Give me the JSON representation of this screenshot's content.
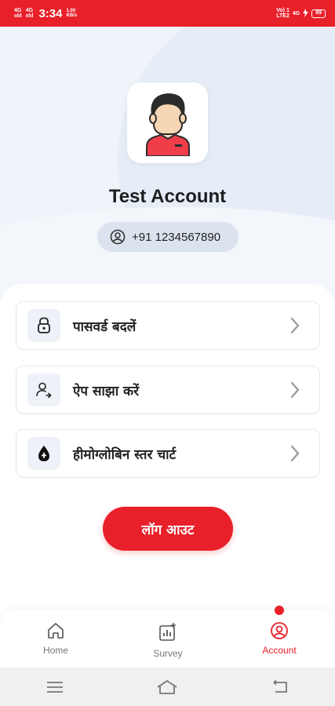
{
  "status_bar": {
    "net1_top": "4G",
    "net1_bottom": "ıılıl",
    "net2_top": "4G",
    "net2_bottom": "ıılıl",
    "time": "3:34",
    "speed_top": "1.00",
    "speed_bottom": "KB/s",
    "volte_top": "Vo) 1",
    "volte_bottom": "LTE2",
    "net3": "4G",
    "battery": "89"
  },
  "profile": {
    "name": "Test Account",
    "phone": "+91 1234567890"
  },
  "menu": [
    {
      "label": "पासवर्ड बदलें",
      "icon": "lock-icon"
    },
    {
      "label": "ऐप साझा करें",
      "icon": "share-user-icon"
    },
    {
      "label": "हीमोग्लोबिन स्तर चार्ट",
      "icon": "blood-drop-icon"
    }
  ],
  "logout_label": "लॉग आउट",
  "bottom_nav": [
    {
      "label": "Home",
      "icon": "home-icon",
      "active": false
    },
    {
      "label": "Survey",
      "icon": "survey-icon",
      "active": false
    },
    {
      "label": "Account",
      "icon": "account-icon",
      "active": true
    }
  ],
  "colors": {
    "accent": "#e8202a",
    "background": "#f0f4fa",
    "text": "#222222"
  }
}
